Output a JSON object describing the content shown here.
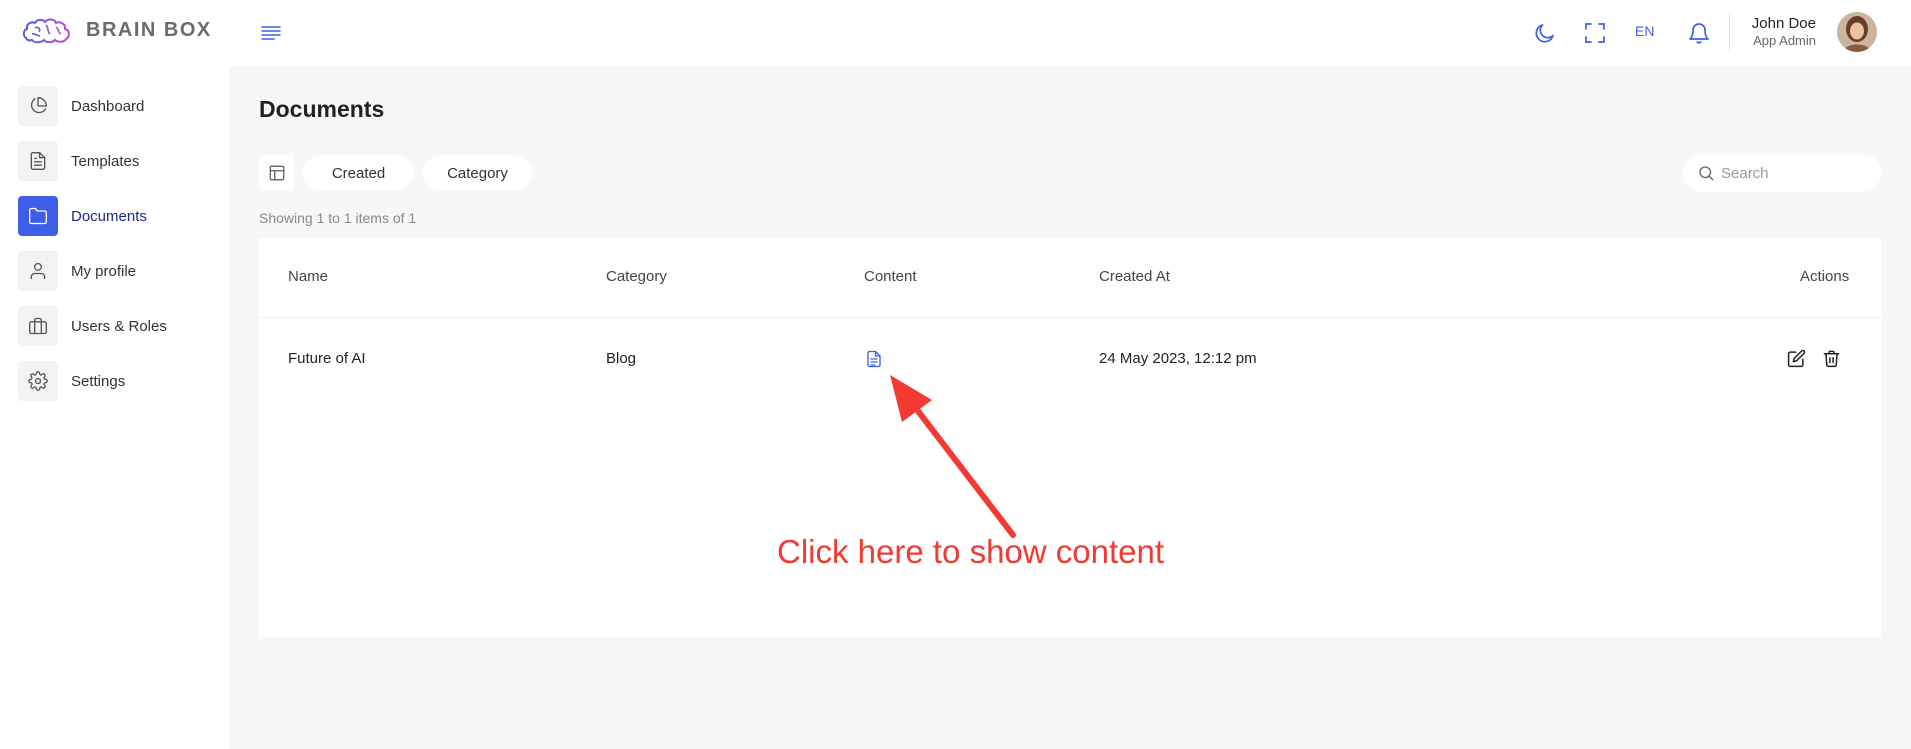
{
  "brand": {
    "name": "BRAIN BOX",
    "accent": "#3f5ee8"
  },
  "header": {
    "language": "EN",
    "user": {
      "name": "John Doe",
      "role": "App Admin"
    }
  },
  "sidebar": {
    "items": [
      {
        "label": "Dashboard",
        "icon": "pie-chart-icon",
        "active": false
      },
      {
        "label": "Templates",
        "icon": "file-text-icon",
        "active": false
      },
      {
        "label": "Documents",
        "icon": "folder-icon",
        "active": true
      },
      {
        "label": "My profile",
        "icon": "user-icon",
        "active": false
      },
      {
        "label": "Users & Roles",
        "icon": "briefcase-icon",
        "active": false
      },
      {
        "label": "Settings",
        "icon": "gear-icon",
        "active": false
      }
    ]
  },
  "main": {
    "title": "Documents",
    "filters": [
      "Created",
      "Category"
    ],
    "search_placeholder": "Search",
    "showing": "Showing 1 to 1 items of 1",
    "table": {
      "columns": [
        "Name",
        "Category",
        "Content",
        "Created At",
        "Actions"
      ],
      "rows": [
        {
          "name": "Future of AI",
          "category": "Blog",
          "content_icon": "document-icon",
          "created_at": "24 May 2023, 12:12 pm"
        }
      ]
    }
  },
  "annotation": {
    "text": "Click here to show content",
    "color": "#f23a33"
  }
}
